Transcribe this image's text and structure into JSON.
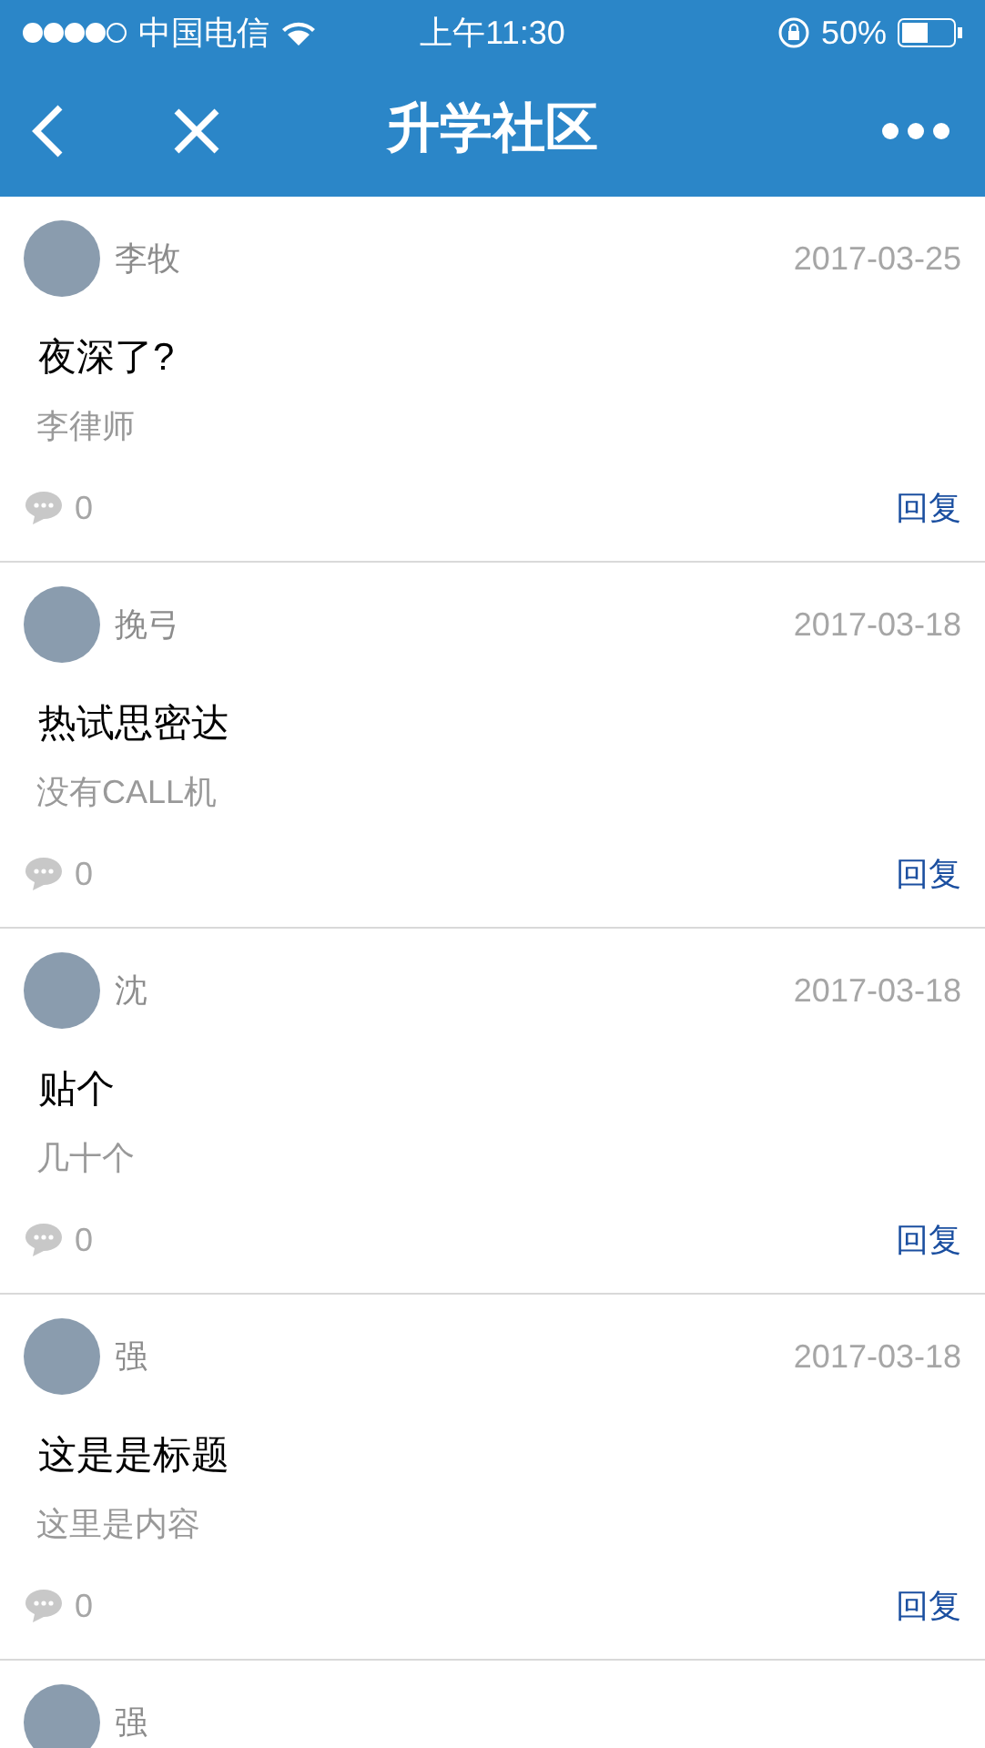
{
  "status_bar": {
    "carrier": "中国电信",
    "time": "上午11:30",
    "battery": "50%"
  },
  "nav": {
    "title": "升学社区"
  },
  "posts": [
    {
      "author": "李牧",
      "date": "2017-03-25",
      "title": "夜深了?",
      "content": "李律师",
      "comments": "0",
      "reply": "回复"
    },
    {
      "author": "挽弓",
      "date": "2017-03-18",
      "title": "热试思密达",
      "content": "没有CALL机",
      "comments": "0",
      "reply": "回复"
    },
    {
      "author": "沈",
      "date": "2017-03-18",
      "title": "贴个",
      "content": "几十个",
      "comments": "0",
      "reply": "回复"
    },
    {
      "author": "强",
      "date": "2017-03-18",
      "title": "这是是标题",
      "content": "这里是内容",
      "comments": "0",
      "reply": "回复"
    },
    {
      "author": "强"
    }
  ]
}
